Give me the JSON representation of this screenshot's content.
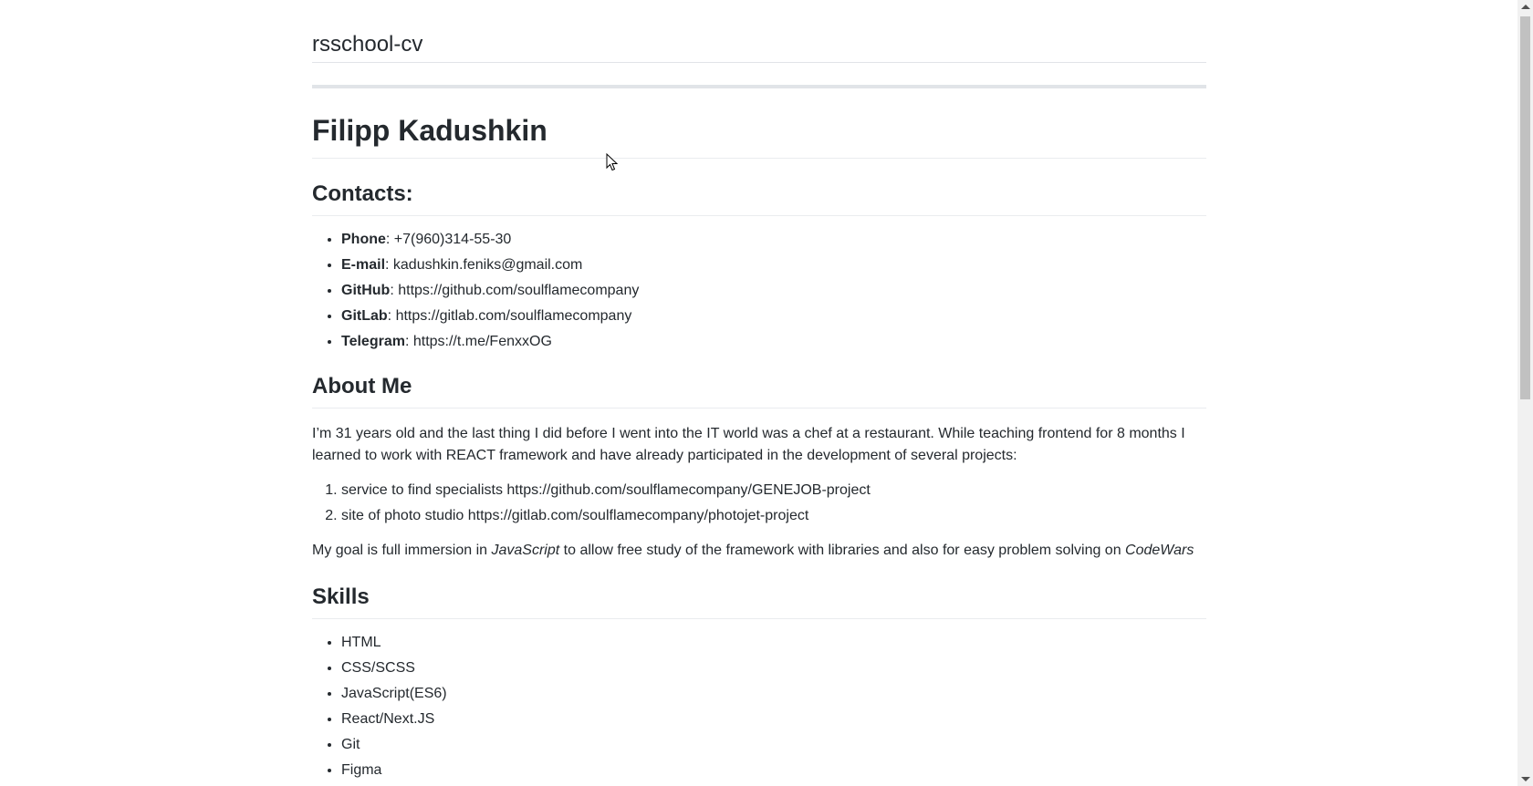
{
  "site": {
    "title": "rsschool-cv"
  },
  "cv": {
    "name": "Filipp Kadushkin",
    "contacts": {
      "heading": "Contacts:",
      "items": [
        {
          "label": "Phone",
          "value": ": +7(960)314-55-30"
        },
        {
          "label": "E-mail",
          "value": ": kadushkin.feniks@gmail.com"
        },
        {
          "label": "GitHub",
          "value": ": https://github.com/soulflamecompany"
        },
        {
          "label": "GitLab",
          "value": ": https://gitlab.com/soulflamecompany"
        },
        {
          "label": "Telegram",
          "value": ": https://t.me/FenxxOG"
        }
      ]
    },
    "about": {
      "heading": "About Me",
      "intro": "I’m 31 years old and the last thing I did before I went into the IT world was a chef at a restaurant. While teaching frontend for 8 months I learned to work with REACT framework and have already participated in the development of several projects:",
      "projects": [
        "service to find specialists https://github.com/soulflamecompany/GENEJOB-project",
        "site of photo studio https://gitlab.com/soulflamecompany/photojet-project"
      ],
      "goal": {
        "part1": "My goal is full immersion in ",
        "em1": "JavaScript",
        "part2": " to allow free study of the framework with libraries and also for easy problem solving on ",
        "em2": "CodeWars"
      }
    },
    "skills": {
      "heading": "Skills",
      "items": [
        "HTML",
        "CSS/SCSS",
        "JavaScript(ES6)",
        "React/Next.JS",
        "Git",
        "Figma"
      ]
    }
  }
}
